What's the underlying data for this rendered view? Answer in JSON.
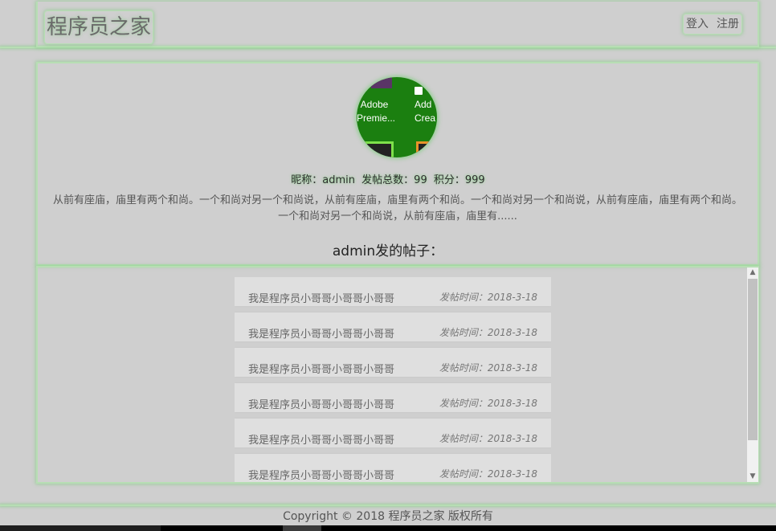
{
  "header": {
    "brand": "程序员之家",
    "login_label": "登入",
    "register_label": "注册"
  },
  "profile": {
    "avatar_icons": [
      "Adobe",
      "Premie...",
      "Add",
      "Crea"
    ],
    "nickname": "昵称：admin",
    "post_count": "发帖总数：99",
    "points": "积分：999",
    "bio": "从前有座庙，庙里有两个和尚。一个和尚对另一个和尚说，从前有座庙，庙里有两个和尚。一个和尚对另一个和尚说，从前有座庙，庙里有两个和尚。一个和尚对另一个和尚说，从前有座庙，庙里有......",
    "posts_heading": "admin发的帖子："
  },
  "posts": [
    {
      "title": "我是程序员小哥哥小哥哥小哥哥",
      "time": "发帖时间：2018-3-18"
    },
    {
      "title": "我是程序员小哥哥小哥哥小哥哥",
      "time": "发帖时间：2018-3-18"
    },
    {
      "title": "我是程序员小哥哥小哥哥小哥哥",
      "time": "发帖时间：2018-3-18"
    },
    {
      "title": "我是程序员小哥哥小哥哥小哥哥",
      "time": "发帖时间：2018-3-18"
    },
    {
      "title": "我是程序员小哥哥小哥哥小哥哥",
      "time": "发帖时间：2018-3-18"
    },
    {
      "title": "我是程序员小哥哥小哥哥小哥哥",
      "time": "发帖时间：2018-3-18"
    }
  ],
  "footer": {
    "copyright": "Copyright © 2018 程序员之家 版权所有"
  },
  "colors": {
    "accent_glow": "#b7deb4",
    "background": "#cfcfcf",
    "post_background": "#dfdfdf",
    "avatar_background": "#1b7f10"
  }
}
